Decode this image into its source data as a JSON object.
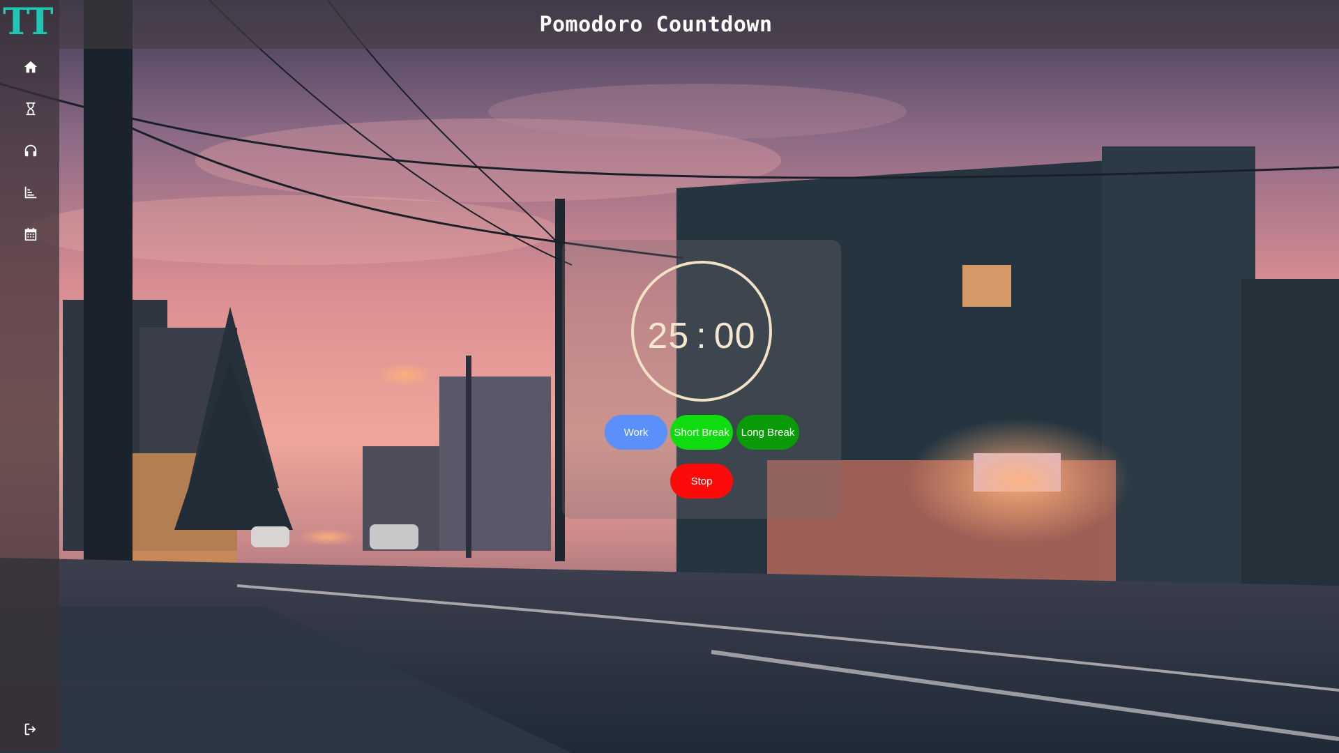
{
  "app": {
    "logo_text": "TT",
    "logo_color": "#1ec7b4"
  },
  "header": {
    "title": "Pomodoro Countdown"
  },
  "sidebar": {
    "items": [
      {
        "icon": "home-icon"
      },
      {
        "icon": "hourglass-icon"
      },
      {
        "icon": "headphones-icon"
      },
      {
        "icon": "chart-icon"
      },
      {
        "icon": "calendar-icon"
      }
    ],
    "logout_icon": "sign-out-icon"
  },
  "timer": {
    "minutes": "25",
    "separator": ":",
    "seconds": "00",
    "ring_color": "#f2e2c4"
  },
  "modes": {
    "work_label": "Work",
    "short_break_label": "Short Break",
    "long_break_label": "Long Break",
    "work_color": "#5b8ff9",
    "short_break_color": "#0fdc0f",
    "long_break_color": "#0a9a0a"
  },
  "controls": {
    "stop_label": "Stop",
    "stop_color": "#ff0a0a"
  }
}
